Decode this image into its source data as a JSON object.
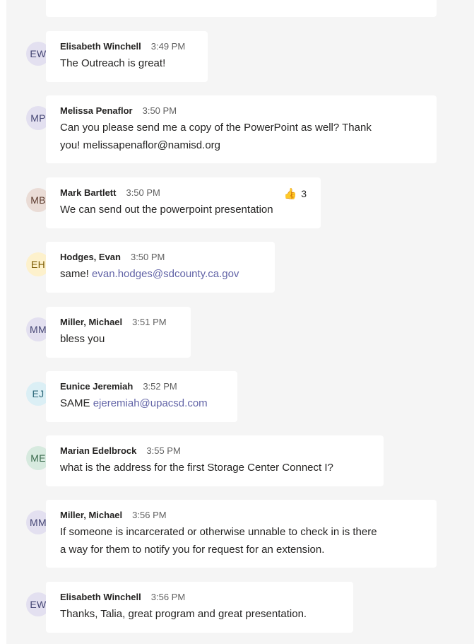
{
  "messages": [
    {
      "id": "m1",
      "initials": "EW",
      "name": "Elisabeth Winchell",
      "time": "3:49 PM",
      "status": "offline",
      "avatar_bg": "#e3e0f0",
      "avatar_fg": "#464775",
      "text": "The Outreach is great!"
    },
    {
      "id": "m2",
      "initials": "MP",
      "name": "Melissa Penaflor",
      "time": "3:50 PM",
      "status": "offline",
      "avatar_bg": "#e3e0f0",
      "avatar_fg": "#464775",
      "text_line1": "Can you please send me a copy of the PowerPoint as well? Thank",
      "text_line2": "you! melissapenaflor@namisd.org"
    },
    {
      "id": "m3",
      "initials": "MB",
      "name": "Mark Bartlett",
      "time": "3:50 PM",
      "status": "offline",
      "avatar_bg": "#eadcd6",
      "avatar_fg": "#5c3b2e",
      "text": "We can send out the powerpoint presentation",
      "reaction": {
        "icon": "thumbs-up-icon",
        "count": "3"
      }
    },
    {
      "id": "m4",
      "initials": "EH",
      "name": "Hodges, Evan",
      "time": "3:50 PM",
      "status": "busy",
      "avatar_bg": "#fdf1cc",
      "avatar_fg": "#7a5a00",
      "text_prefix": "same! ",
      "link": "evan.hodges@sdcounty.ca.gov"
    },
    {
      "id": "m5",
      "initials": "MM",
      "name": "Miller, Michael",
      "time": "3:51 PM",
      "status": "busy",
      "avatar_bg": "#e3e0f0",
      "avatar_fg": "#464775",
      "text": "bless you"
    },
    {
      "id": "m6",
      "initials": "EJ",
      "name": "Eunice Jeremiah",
      "time": "3:52 PM",
      "status": "offline",
      "avatar_bg": "#dbeff5",
      "avatar_fg": "#2e6a7b",
      "text_prefix": "SAME ",
      "link": "ejeremiah@upacsd.com"
    },
    {
      "id": "m7",
      "initials": "ME",
      "name": "Marian Edelbrock",
      "time": "3:55 PM",
      "status": "offline",
      "avatar_bg": "#d7eadf",
      "avatar_fg": "#3b6b4e",
      "text": "what is the address for the first Storage Center Connect I?"
    },
    {
      "id": "m8",
      "initials": "MM",
      "name": "Miller, Michael",
      "time": "3:56 PM",
      "status": "busy",
      "avatar_bg": "#e3e0f0",
      "avatar_fg": "#464775",
      "text_line1": "If someone is incarcerated or otherwise unnable to check in is there",
      "text_line2": "a way for them to notify you for request for an extension."
    },
    {
      "id": "m9",
      "initials": "EW",
      "name": "Elisabeth Winchell",
      "time": "3:56 PM",
      "status": "offline",
      "avatar_bg": "#e3e0f0",
      "avatar_fg": "#464775",
      "text": "Thanks, Talia, great program and great presentation."
    }
  ]
}
